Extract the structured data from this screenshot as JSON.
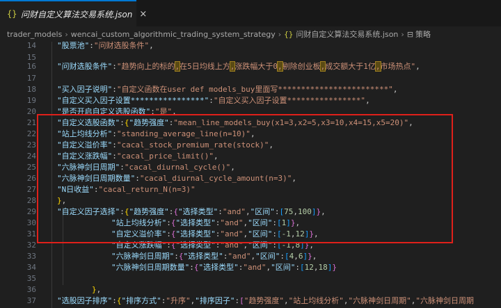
{
  "tab": {
    "icon": "{}",
    "title": "问财自定义算法交易系统.json",
    "close": "×"
  },
  "breadcrumb": {
    "items": [
      "trader_models",
      "wencai_custom_algorithmic_trading_system_strategy",
      "问财自定义算法交易系统.json",
      "策略"
    ],
    "file_icon": "{}",
    "section_icon": "⊟",
    "separator": "›"
  },
  "line_numbers": [
    "14",
    "15",
    "16",
    "17",
    "18",
    "19",
    "20",
    "21",
    "22",
    "23",
    "24",
    "25",
    "26",
    "27",
    "28",
    "29",
    "30",
    "31",
    "32",
    "33",
    "34",
    "35",
    "36",
    "37"
  ],
  "code": {
    "l14": {
      "key": "\"股票池\"",
      "val": "\"问财选股条件\""
    },
    "l16": {
      "key": "\"问财选股条件\"",
      "v1": "\"趋势向上的标的",
      "h1": ",",
      "v2": "在5日均线上方",
      "h2": ",",
      "v3": "涨跌幅大于0",
      "h3": ",",
      "v4": "剔除创业板",
      "h4": ",",
      "v5": "成交额大于1亿",
      "h5": ",",
      "v6": "市场热点\""
    },
    "l18": {
      "key": "\"买入因子说明\"",
      "val": "\"自定义函数在user def models_buy里面写************************\""
    },
    "l19": {
      "key": "\"自定义买入因子设置****************\"",
      "val": "\"自定义买入因子设置****************\""
    },
    "l20": {
      "key": "\"是否开启自定义选股函数\"",
      "val": "\"是\""
    },
    "l21": {
      "key": "\"自定义选股函数\"",
      "subkey": "\"趋势强度\"",
      "val": "\"mean_line_models_buy(x1=3,x2=5,x3=10,x4=15,x5=20)\""
    },
    "l22": {
      "key": "\"站上均线分析\"",
      "val": "\"standing_average_line(n=10)\""
    },
    "l23": {
      "key": "\"自定义溢价率\"",
      "val": "\"cacal_stock_premium_rate(stock)\""
    },
    "l24": {
      "key": "\"自定义涨跌幅\"",
      "val": "\"cacal_price_limit()\""
    },
    "l25": {
      "key": "\"六脉神剑日周期\"",
      "val": "\"cacal_diurnal_cycle()\""
    },
    "l26": {
      "key": "\"六脉神剑日周期数量\"",
      "val": "\"cacal_diurnal_cycle_amount(n=3)\""
    },
    "l27": {
      "key": "\"N日收益\"",
      "val": "\"cacal_return_N(n=3)\""
    },
    "l29": {
      "key": "\"自定义因子选择\"",
      "f1": "\"趋势强度\"",
      "t": "\"选择类型\"",
      "tv": "\"and\"",
      "r": "\"区间\"",
      "a": "75",
      "b": "100"
    },
    "l30": {
      "f": "\"站上均线分析\"",
      "a": "1"
    },
    "l31": {
      "f": "\"自定义溢价率\"",
      "a": "-1",
      "b": "12"
    },
    "l32": {
      "f": "\"自定义涨跌幅\"",
      "a": "-1",
      "b": "8"
    },
    "l33": {
      "f": "\"六脉神剑日周期\"",
      "a": "4",
      "b": "6"
    },
    "l34": {
      "f": "\"六脉神剑日周期数量\"",
      "a": "12",
      "b": "18"
    },
    "l37": {
      "key": "\"选股因子排序\"",
      "m": "\"排序方式\"",
      "mv": "\"升序\"",
      "f": "\"排序因子\"",
      "f1": "\"趋势强度\"",
      "f2": "\"站上均线分析\"",
      "f3": "\"六脉神剑日周期\"",
      "f4": "\"六脉神剑日周期"
    }
  },
  "colors": {
    "highlight_box": "#e0201a",
    "key": "#9cdcfe",
    "string": "#ce9178",
    "tab_accent": "#0078d4"
  }
}
